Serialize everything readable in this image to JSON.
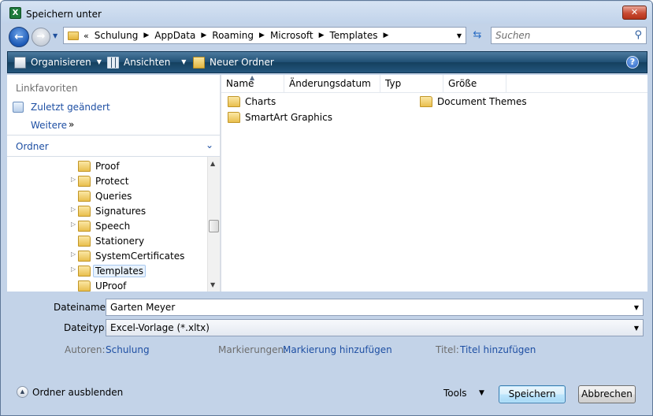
{
  "window": {
    "title": "Speichern unter",
    "app_icon": "excel-icon",
    "close_label": "✕"
  },
  "address": {
    "overflow": "«",
    "crumbs": [
      "Schulung",
      "AppData",
      "Roaming",
      "Microsoft",
      "Templates"
    ]
  },
  "search": {
    "placeholder": "Suchen"
  },
  "toolbar": {
    "organize_label": "Organisieren",
    "views_label": "Ansichten",
    "new_folder_label": "Neuer Ordner",
    "help_label": "?"
  },
  "nav": {
    "favorites_header": "Linkfavoriten",
    "recent_label": "Zuletzt geändert",
    "more_label": "Weitere",
    "more_arrows": "»",
    "folders_header": "Ordner",
    "tree": [
      {
        "label": "Proof",
        "expandable": false
      },
      {
        "label": "Protect",
        "expandable": true
      },
      {
        "label": "Queries",
        "expandable": false
      },
      {
        "label": "Signatures",
        "expandable": true
      },
      {
        "label": "Speech",
        "expandable": true
      },
      {
        "label": "Stationery",
        "expandable": false
      },
      {
        "label": "SystemCertificates",
        "expandable": true
      },
      {
        "label": "Templates",
        "expandable": true,
        "selected": true
      },
      {
        "label": "UProof",
        "expandable": false
      }
    ]
  },
  "content": {
    "columns": [
      "Name",
      "Änderungsdatum",
      "Typ",
      "Größe"
    ],
    "items": [
      "Charts",
      "SmartArt Graphics",
      "Document Themes"
    ]
  },
  "form": {
    "filename_label": "Dateiname:",
    "filename_value": "Garten Meyer",
    "filetype_label": "Dateityp:",
    "filetype_value": "Excel-Vorlage (*.xltx)",
    "authors_label": "Autoren:",
    "authors_value": "Schulung",
    "tags_label": "Markierungen:",
    "tags_value": "Markierung hinzufügen",
    "title_label": "Titel:",
    "title_value": "Titel hinzufügen"
  },
  "footer": {
    "hide_folders_label": "Ordner ausblenden",
    "tools_label": "Tools",
    "save_label": "Speichern",
    "cancel_label": "Abbrechen"
  },
  "colors": {
    "link_blue": "#1e4fa3",
    "toolbar_dark": "#1f4f74",
    "chrome": "#c3d3e8"
  }
}
